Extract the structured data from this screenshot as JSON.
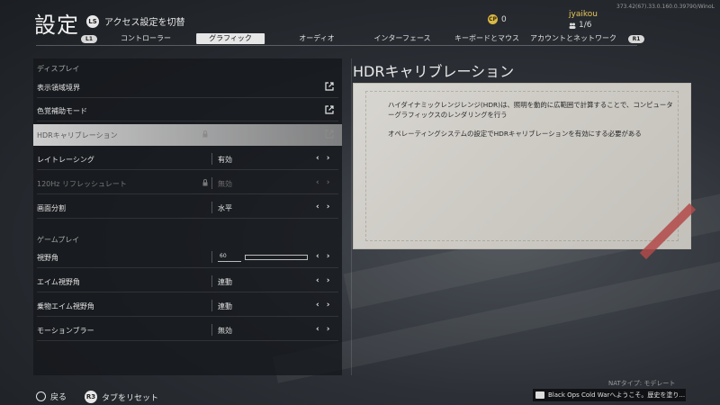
{
  "header": {
    "title": "設定",
    "access_toggle": {
      "glyph": "LS",
      "label": "アクセス設定を切替"
    },
    "currency": {
      "icon": "cod-points-icon",
      "value": "0"
    },
    "user": {
      "name": "jyaikou",
      "party": "1/6"
    },
    "build_info": "373.42(67).33.0.160.0.39790/WinoL"
  },
  "tabs": {
    "left_pill": "L1",
    "right_pill": "R1",
    "items": [
      {
        "label": "コントローラー"
      },
      {
        "label": "グラフィック",
        "active": true
      },
      {
        "label": "オーディオ"
      },
      {
        "label": "インターフェース"
      },
      {
        "label": "キーボードとマウス"
      },
      {
        "label": "アカウントとネットワーク"
      }
    ]
  },
  "settings": {
    "display_header": "ディスプレイ",
    "rows": [
      {
        "label": "表示領域境界",
        "type": "external"
      },
      {
        "label": "色覚補助モード",
        "type": "external"
      },
      {
        "label": "HDRキャリブレーション",
        "type": "external",
        "highlight": true,
        "locked": true
      },
      {
        "label": "レイトレーシング",
        "value": "有効"
      },
      {
        "label": "120Hz リフレッシュレート",
        "value": "無効",
        "disabled": true,
        "locked": true
      },
      {
        "label": "画面分割",
        "value": "水平"
      }
    ],
    "gameplay_header": "ゲームプレイ",
    "gameplay_rows": [
      {
        "label": "視野角",
        "value": "60",
        "type": "slider",
        "fill": 0.0
      },
      {
        "label": "エイム視野角",
        "value": "連動"
      },
      {
        "label": "乗物エイム視野角",
        "value": "連動"
      },
      {
        "label": "モーションブラー",
        "value": "無効"
      }
    ]
  },
  "description": {
    "title": "HDRキャリブレーション",
    "paragraph1": "ハイダイナミックレンジレンジ(HDR)は、照明を動的に広範囲で計算することで、コンピューターグラフィックスのレンダリングを行う",
    "paragraph2": "オペレーティングシステムの設定でHDRキャリブレーションを有効にする必要がある"
  },
  "footer": {
    "back_label": "戻る",
    "reset_glyph": "R3",
    "reset_label": "タブをリセット",
    "nat_type": "NATタイプ: モデレート",
    "notification": "Black Ops Cold Warへようこそ。歴史を塗り..."
  },
  "colors": {
    "accent_user": "#e8c65a",
    "ribbon": "#b24a4a",
    "highlight_row": "#d7d7d7"
  }
}
